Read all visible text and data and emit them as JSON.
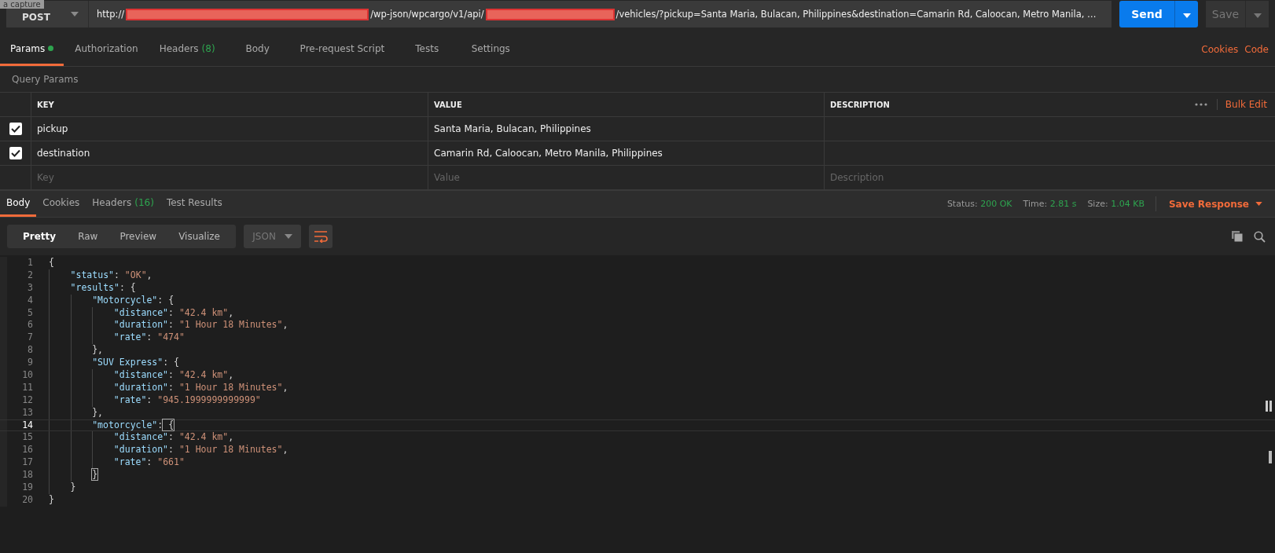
{
  "tooltip": "a capture",
  "request": {
    "method": "POST",
    "url_parts": [
      {
        "kind": "text",
        "text": "http://"
      },
      {
        "kind": "redacted"
      },
      {
        "kind": "text",
        "text": "/wp-json/wpcargo/v1/api/"
      },
      {
        "kind": "redacted"
      },
      {
        "kind": "text",
        "text": "/vehicles/?pickup=Santa Maria, Bulacan, Philippines&destination=Camarin Rd, Caloocan, Metro Manila, …"
      }
    ],
    "send": "Send",
    "save": "Save"
  },
  "request_tabs": [
    {
      "label": "Params",
      "dot": true,
      "selected": true
    },
    {
      "label": "Authorization",
      "dot": false,
      "selected": false
    },
    {
      "label": "Headers",
      "count": "(8)",
      "dot": false,
      "selected": false
    },
    {
      "label": "Body",
      "dot": false,
      "selected": false
    },
    {
      "label": "Pre-request Script",
      "dot": false,
      "selected": false
    },
    {
      "label": "Tests",
      "dot": false,
      "selected": false
    },
    {
      "label": "Settings",
      "dot": false,
      "selected": false
    }
  ],
  "request_links": [
    "Cookies",
    "Code"
  ],
  "query_params": {
    "title": "Query Params",
    "columns": [
      "KEY",
      "VALUE",
      "DESCRIPTION"
    ],
    "bulk_edit": "Bulk Edit",
    "rows": [
      {
        "key": "pickup",
        "value": "Santa Maria, Bulacan, Philippines",
        "checked": true
      },
      {
        "key": "destination",
        "value": "Camarin Rd, Caloocan, Metro Manila, Philippines",
        "checked": true
      }
    ],
    "empty_row": [
      {
        "placeholder": "Key"
      },
      {
        "placeholder": "Value"
      },
      {
        "placeholder": "Description"
      }
    ]
  },
  "response_tabs": [
    {
      "label": "Body",
      "selected": true
    },
    {
      "label": "Cookies",
      "selected": false
    },
    {
      "label": "Headers",
      "count": "(16)",
      "selected": false
    },
    {
      "label": "Test Results",
      "selected": false
    }
  ],
  "response_stats": [
    {
      "label": "Status:",
      "value": "200 OK"
    },
    {
      "label": "Time:",
      "value": "2.81 s"
    },
    {
      "label": "Size:",
      "value": "1.04 KB"
    }
  ],
  "save_response": "Save Response",
  "view_modes": [
    {
      "label": "Pretty",
      "selected": true
    },
    {
      "label": "Raw",
      "selected": false
    },
    {
      "label": "Preview",
      "selected": false
    },
    {
      "label": "Visualize",
      "selected": false
    }
  ],
  "format": "JSON",
  "code_lines": [
    {
      "number": "1",
      "text": "{",
      "selected": false,
      "bracket": false
    },
    {
      "number": "2",
      "text": "    \"status\": \"OK\",",
      "selected": false,
      "bracket": false
    },
    {
      "number": "3",
      "text": "    \"results\": {",
      "selected": false,
      "bracket": false
    },
    {
      "number": "4",
      "text": "        \"Motorcycle\": {",
      "selected": false,
      "bracket": false
    },
    {
      "number": "5",
      "text": "            \"distance\": \"42.4 km\",",
      "selected": false,
      "bracket": false
    },
    {
      "number": "6",
      "text": "            \"duration\": \"1 Hour 18 Minutes\",",
      "selected": false,
      "bracket": false
    },
    {
      "number": "7",
      "text": "            \"rate\": \"474\"",
      "selected": false,
      "bracket": false
    },
    {
      "number": "8",
      "text": "        },",
      "selected": false,
      "bracket": false
    },
    {
      "number": "9",
      "text": "        \"SUV Express\": {",
      "selected": false,
      "bracket": false
    },
    {
      "number": "10",
      "text": "            \"distance\": \"42.4 km\",",
      "selected": false,
      "bracket": false
    },
    {
      "number": "11",
      "text": "            \"duration\": \"1 Hour 18 Minutes\",",
      "selected": false,
      "bracket": false
    },
    {
      "number": "12",
      "text": "            \"rate\": \"945.1999999999999\"",
      "selected": false,
      "bracket": false
    },
    {
      "number": "13",
      "text": "        },",
      "selected": false,
      "bracket": false
    },
    {
      "number": "14",
      "text": "        \"motorcycle\": {",
      "selected": true,
      "bracket": true
    },
    {
      "number": "15",
      "text": "            \"distance\": \"42.4 km\",",
      "selected": false,
      "bracket": false
    },
    {
      "number": "16",
      "text": "            \"duration\": \"1 Hour 18 Minutes\",",
      "selected": false,
      "bracket": false
    },
    {
      "number": "17",
      "text": "            \"rate\": \"661\"",
      "selected": false,
      "bracket": false
    },
    {
      "number": "18",
      "text": "        }",
      "selected": false,
      "bracket": true
    },
    {
      "number": "19",
      "text": "    }",
      "selected": false,
      "bracket": false
    },
    {
      "number": "20",
      "text": "}",
      "selected": false,
      "bracket": false
    }
  ]
}
